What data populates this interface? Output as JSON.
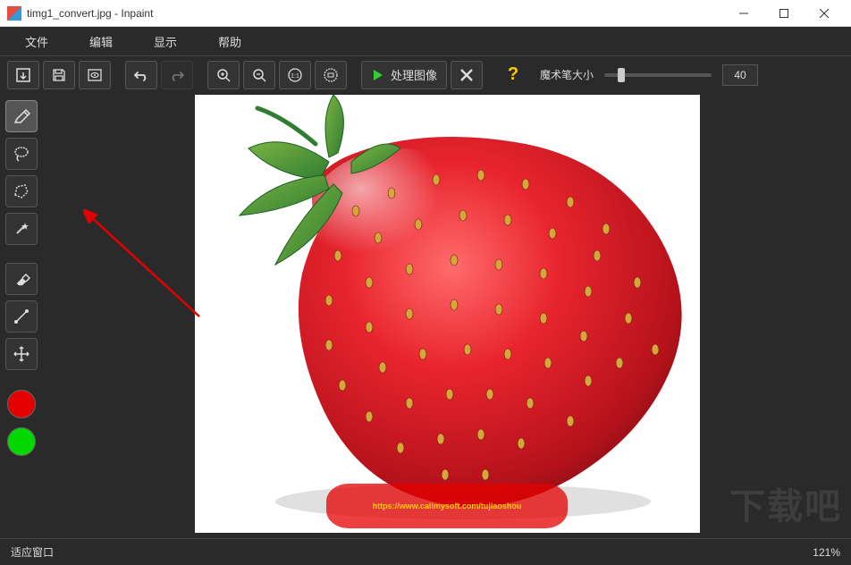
{
  "window": {
    "title": "timg1_convert.jpg - Inpaint"
  },
  "menu": {
    "file": "文件",
    "edit": "编辑",
    "view": "显示",
    "help": "帮助"
  },
  "toolbar": {
    "process_label": "处理图像",
    "brush_size_label": "魔术笔大小",
    "size_value": "40"
  },
  "painted": {
    "url_text": "https://www.callmysoft.com/tujiaoshou"
  },
  "statusbar": {
    "fit_window": "适应窗口",
    "zoom": "121%"
  },
  "watermark": "下载吧",
  "colors": {
    "accent_green": "#00d800",
    "accent_red": "#e50000",
    "bg_dark": "#2a2a2a"
  }
}
